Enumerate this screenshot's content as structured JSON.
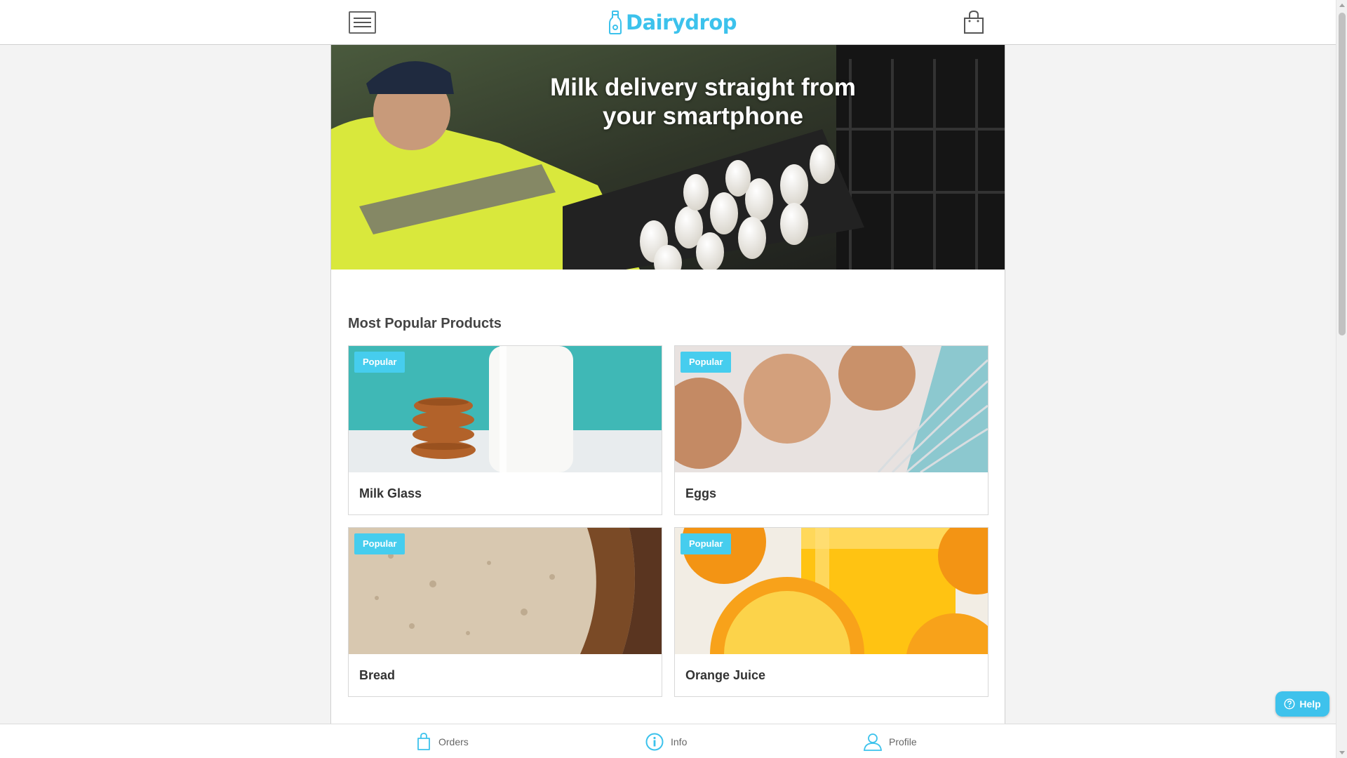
{
  "header": {
    "brand": "Dairydrop",
    "menu_icon": "hamburger-menu-icon",
    "logo_icon": "milk-bottle-icon",
    "cart_icon": "shopping-bag-icon"
  },
  "hero": {
    "title": "Milk delivery straight from your smartphone"
  },
  "section": {
    "title": "Most Popular Products"
  },
  "products": [
    {
      "name": "Milk Glass",
      "badge": "Popular"
    },
    {
      "name": "Eggs",
      "badge": "Popular"
    },
    {
      "name": "Bread",
      "badge": "Popular"
    },
    {
      "name": "Orange Juice",
      "badge": "Popular"
    }
  ],
  "bottom_nav": {
    "items": [
      {
        "label": "Orders",
        "icon": "shopping-bag-icon"
      },
      {
        "label": "Info",
        "icon": "info-icon"
      },
      {
        "label": "Profile",
        "icon": "user-icon"
      }
    ]
  },
  "help": {
    "label": "Help",
    "icon": "question-circle-icon"
  },
  "colors": {
    "accent": "#3cc2ec",
    "badge": "#46cdee"
  }
}
